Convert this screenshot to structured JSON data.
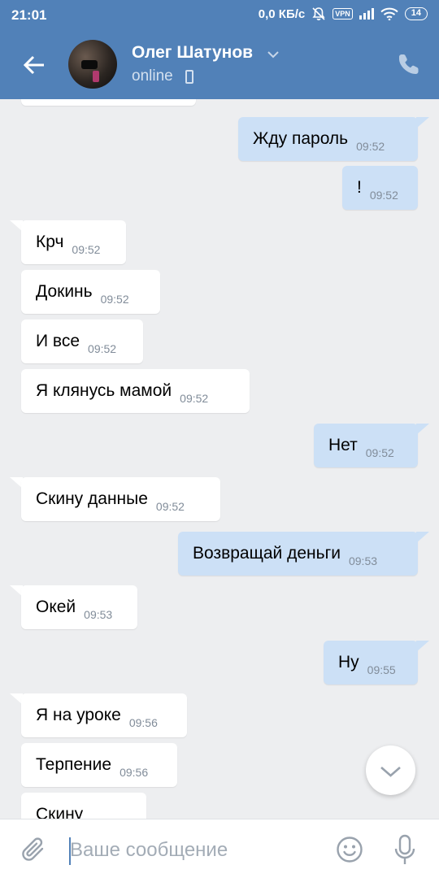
{
  "status_bar": {
    "time": "21:01",
    "network_speed": "0,0 КБ/с",
    "vpn_label": "VPN",
    "battery": "14"
  },
  "header": {
    "name": "Олег Шатунов",
    "status": "online"
  },
  "messages": [
    {
      "text": "Жду пароль",
      "time": "09:52",
      "dir": "out"
    },
    {
      "text": "!",
      "time": "09:52",
      "dir": "out"
    },
    {
      "text": "Крч",
      "time": "09:52",
      "dir": "in"
    },
    {
      "text": "Докинь",
      "time": "09:52",
      "dir": "in"
    },
    {
      "text": "И все",
      "time": "09:52",
      "dir": "in"
    },
    {
      "text": "Я клянусь мамой",
      "time": "09:52",
      "dir": "in"
    },
    {
      "text": "Нет",
      "time": "09:52",
      "dir": "out"
    },
    {
      "text": "Скину данные",
      "time": "09:52",
      "dir": "in"
    },
    {
      "text": "Возвращай деньги",
      "time": "09:53",
      "dir": "out"
    },
    {
      "text": "Окей",
      "time": "09:53",
      "dir": "in"
    },
    {
      "text": "Ну",
      "time": "09:55",
      "dir": "out"
    },
    {
      "text": "Я на уроке",
      "time": "09:56",
      "dir": "in"
    },
    {
      "text": "Терпение",
      "time": "09:56",
      "dir": "in"
    },
    {
      "text": "Скину",
      "time": "",
      "dir": "in"
    }
  ],
  "composer": {
    "placeholder": "Ваше сообщение"
  },
  "colors": {
    "header_bg": "#5181b8",
    "chat_bg": "#edeef0",
    "outgoing_bubble": "#cce0f6",
    "incoming_bubble": "#ffffff",
    "time_text": "#818c99",
    "icon_grey": "#99a2ad"
  },
  "icons": [
    "back-arrow-icon",
    "chevron-down-icon",
    "mobile-icon",
    "phone-icon",
    "attach-icon",
    "emoji-icon",
    "mic-icon",
    "scroll-down-icon",
    "bell-off-icon",
    "signal-icon",
    "wifi-icon",
    "battery-icon"
  ]
}
